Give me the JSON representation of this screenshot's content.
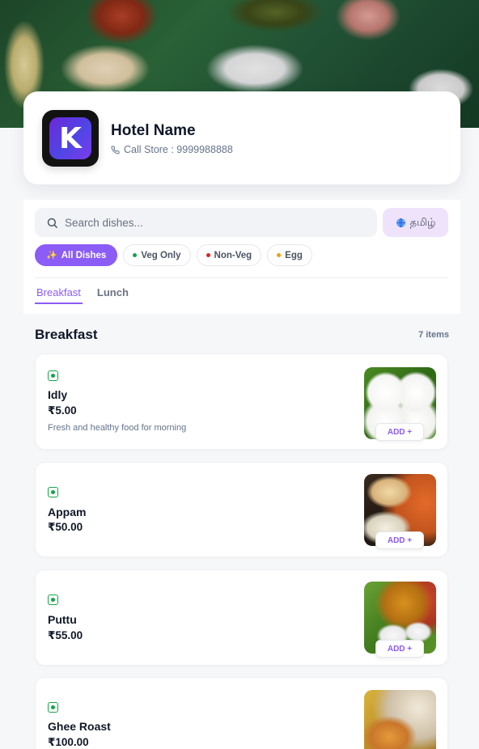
{
  "store": {
    "logo_letter": "K",
    "name": "Hotel Name",
    "phone": "Call Store : 9999988888"
  },
  "search": {
    "placeholder": "Search dishes..."
  },
  "language_button": {
    "label": "தமிழ்"
  },
  "filters": [
    {
      "label": "All Dishes",
      "active": true,
      "icon": "sparkle-icon"
    },
    {
      "label": "Veg Only",
      "dot_color": "#16a34a"
    },
    {
      "label": "Non-Veg",
      "dot_color": "#dc2626"
    },
    {
      "label": "Egg",
      "dot_color": "#f59e0b"
    }
  ],
  "tabs": [
    {
      "label": "Breakfast",
      "active": true
    },
    {
      "label": "Lunch"
    }
  ],
  "section": {
    "title": "Breakfast",
    "count": "7 items"
  },
  "items": [
    {
      "name": "Idly",
      "price": "₹5.00",
      "description": "Fresh and healthy food for morning",
      "veg": true,
      "add_label": "ADD +"
    },
    {
      "name": "Appam",
      "price": "₹50.00",
      "veg": true,
      "add_label": "ADD +"
    },
    {
      "name": "Puttu",
      "price": "₹55.00",
      "veg": true,
      "add_label": "ADD +"
    },
    {
      "name": "Ghee Roast",
      "price": "₹100.00",
      "veg": true
    }
  ],
  "colors": {
    "accent": "#8b5cf6",
    "veg": "#16a34a",
    "non_veg": "#dc2626",
    "egg": "#f59e0b"
  }
}
